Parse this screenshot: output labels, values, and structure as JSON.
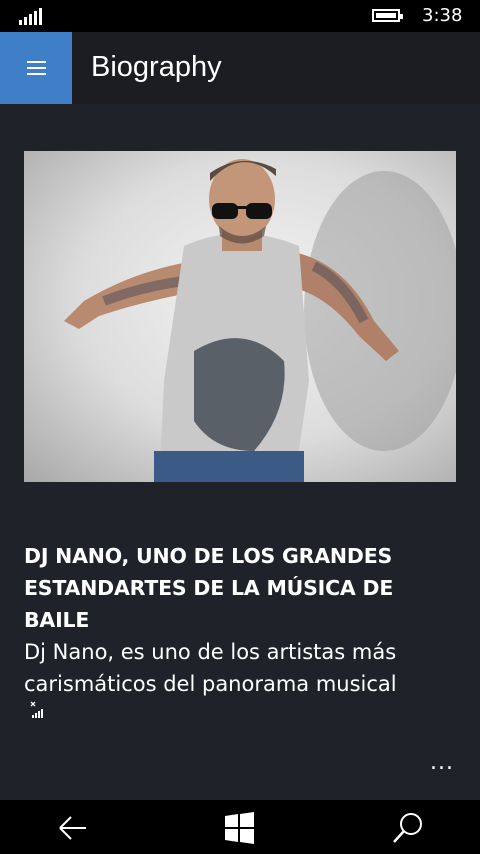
{
  "status_bar": {
    "time": "3:38"
  },
  "header": {
    "title": "Biography",
    "menu_icon": "hamburger-icon"
  },
  "article": {
    "image_alt": "DJ Nano photo",
    "headline": "DJ NANO, UNO DE LOS GRANDES ESTANDARTES DE LA MÚSICA DE BAILE",
    "body": "Dj Nano, es uno de los artistas más carismáticos del panorama musical"
  },
  "app_bar": {
    "more": "..."
  },
  "nav": {
    "back": "back-icon",
    "home": "windows-icon",
    "search": "search-icon"
  },
  "colors": {
    "accent": "#3f7fc8",
    "background": "#1f2229"
  }
}
